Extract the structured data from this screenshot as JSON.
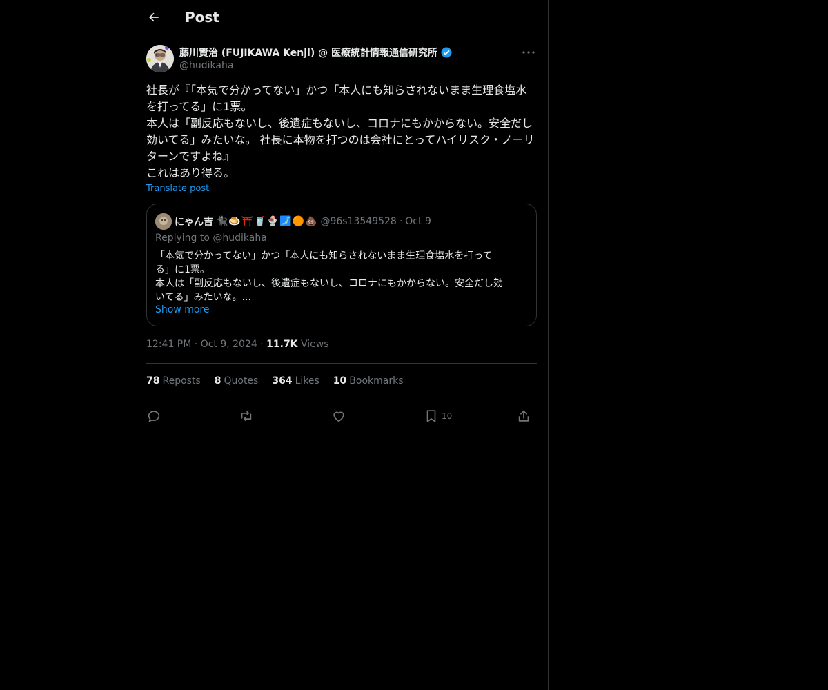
{
  "header": {
    "title": "Post"
  },
  "post": {
    "display_name": "藤川賢治 (FUJIKAWA Kenji) @ 医療統計情報通信研究所",
    "handle": "@hudikaha",
    "verified": true,
    "text_lines": [
      "社長が『「本気で分かってない」かつ「本人にも知らされないまま生理食塩水を打ってる」に1票。",
      "本人は「副反応もないし、後遺症もないし、コロナにもかからない。安全だし効いてる」みたいな。 社長に本物を打つのは会社にとってハイリスク・ノーリターンですよね』",
      "これはあり得る。"
    ],
    "translate_label": "Translate post",
    "time": "12:41 PM",
    "date": "Oct 9, 2024",
    "views_count": "11.7K",
    "views_label": "Views"
  },
  "quote": {
    "name": "にゃん吉",
    "emoji": "🐈‍⬛🍮⛩️🥤🍨🗾🟠💩",
    "handle": "@96s13549528",
    "separator": "·",
    "date": "Oct 9",
    "replying_to": "Replying to @hudikaha",
    "text_lines": [
      "「本気で分かってない」かつ「本人にも知らされないまま生理食塩水を打って",
      "る」に1票。",
      "本人は「副反応もないし、後遺症もないし、コロナにもかからない。安全だし効",
      "いてる」みたいな。..."
    ],
    "show_more": "Show more"
  },
  "stats": {
    "reposts": {
      "count": "78",
      "label": "Reposts"
    },
    "quotes": {
      "count": "8",
      "label": "Quotes"
    },
    "likes": {
      "count": "364",
      "label": "Likes"
    },
    "bookmarks": {
      "count": "10",
      "label": "Bookmarks"
    }
  },
  "actions": {
    "reply_icon": "reply-icon",
    "repost_icon": "repost-icon",
    "like_icon": "heart-icon",
    "bookmark_icon": "bookmark-icon",
    "bookmark_count": "10",
    "share_icon": "share-icon"
  },
  "colors": {
    "background": "#000000",
    "border": "#2f3336",
    "text": "#e7e9ea",
    "muted": "#71767b",
    "accent": "#1d9bf0"
  }
}
